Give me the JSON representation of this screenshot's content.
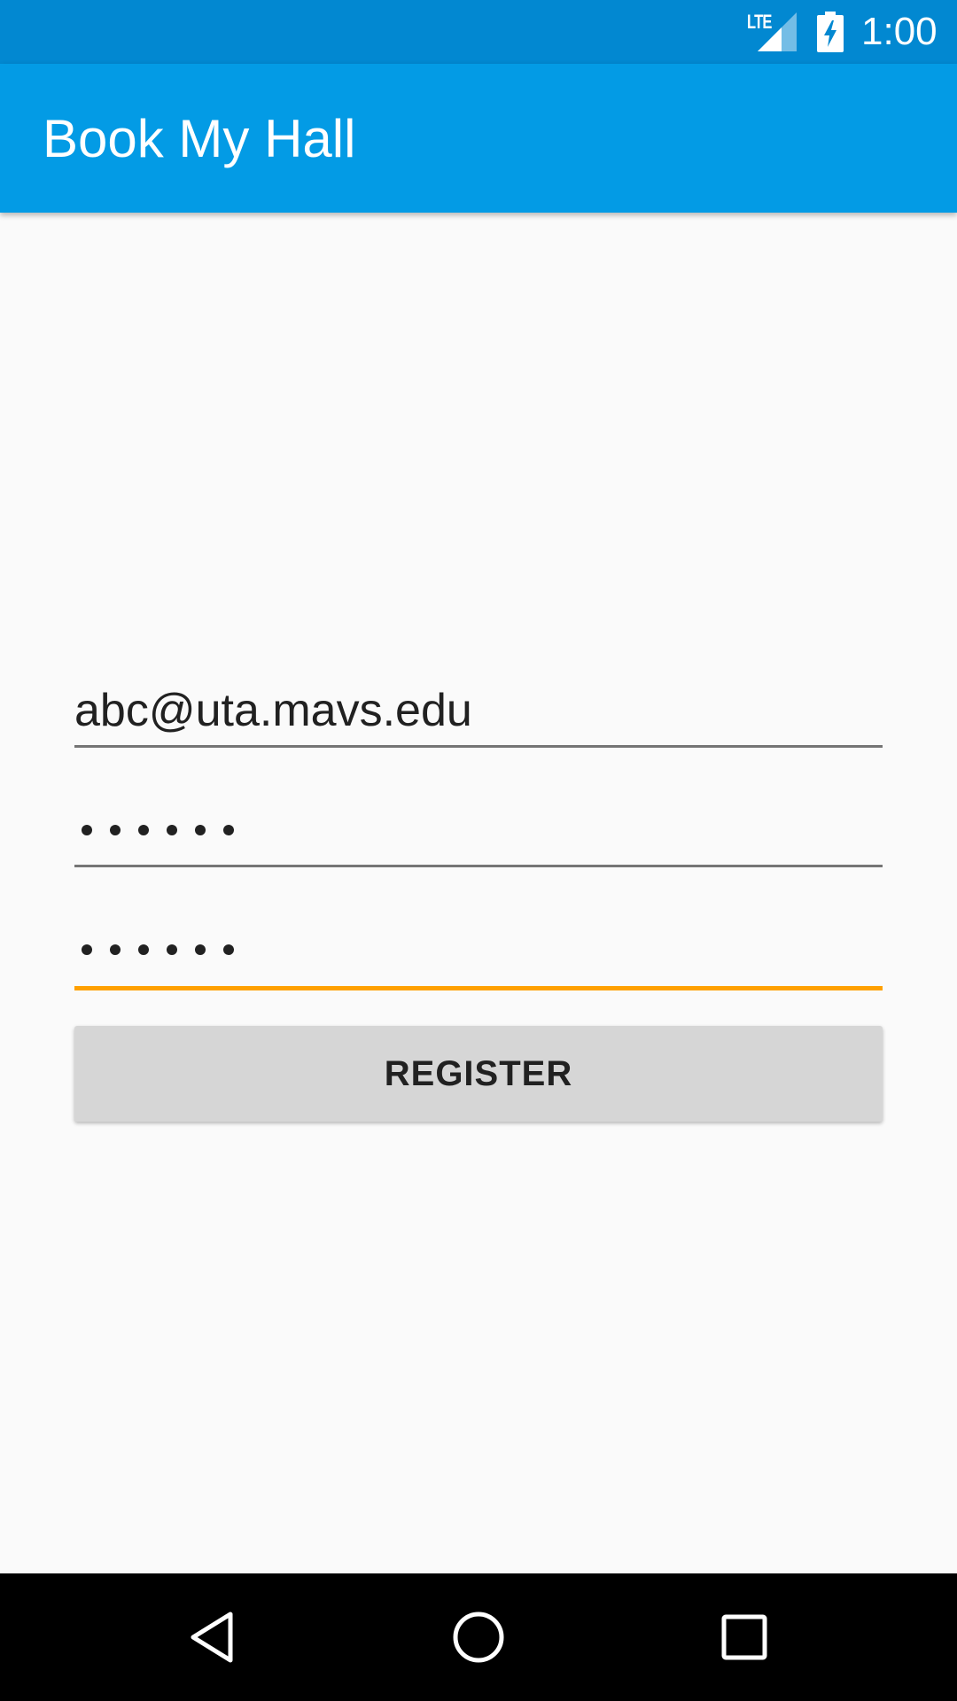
{
  "status_bar": {
    "network_label": "LTE",
    "time": "1:00",
    "icons": [
      "signal-icon",
      "battery-charging-icon"
    ]
  },
  "app_bar": {
    "title": "Book My Hall"
  },
  "form": {
    "email_value": "abc@uta.mavs.edu",
    "password_masked": "••••••",
    "confirm_password_masked": "••••••",
    "register_label": "REGISTER"
  },
  "nav_bar": {
    "icons": [
      "back-icon",
      "home-icon",
      "recents-icon"
    ]
  },
  "colors": {
    "status_bar": "#0288D1",
    "app_bar": "#039BE5",
    "background": "#FAFAFA",
    "focused_accent": "#FFA000",
    "button": "#D6D6D6"
  }
}
